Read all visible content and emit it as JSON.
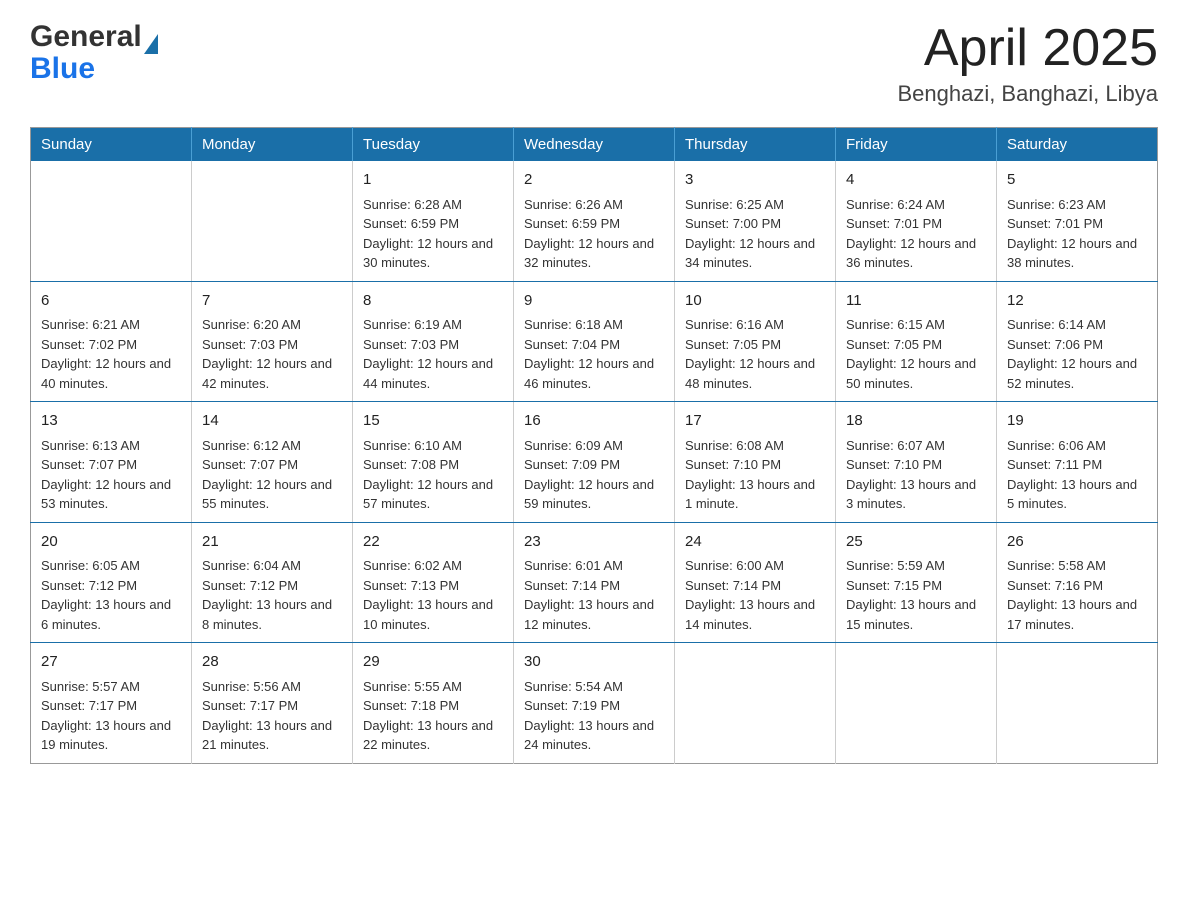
{
  "header": {
    "logo_general": "General",
    "logo_blue": "Blue",
    "month_title": "April 2025",
    "location": "Benghazi, Banghazi, Libya"
  },
  "days_of_week": [
    "Sunday",
    "Monday",
    "Tuesday",
    "Wednesday",
    "Thursday",
    "Friday",
    "Saturday"
  ],
  "weeks": [
    [
      {
        "day": "",
        "sunrise": "",
        "sunset": "",
        "daylight": ""
      },
      {
        "day": "",
        "sunrise": "",
        "sunset": "",
        "daylight": ""
      },
      {
        "day": "1",
        "sunrise": "Sunrise: 6:28 AM",
        "sunset": "Sunset: 6:59 PM",
        "daylight": "Daylight: 12 hours and 30 minutes."
      },
      {
        "day": "2",
        "sunrise": "Sunrise: 6:26 AM",
        "sunset": "Sunset: 6:59 PM",
        "daylight": "Daylight: 12 hours and 32 minutes."
      },
      {
        "day": "3",
        "sunrise": "Sunrise: 6:25 AM",
        "sunset": "Sunset: 7:00 PM",
        "daylight": "Daylight: 12 hours and 34 minutes."
      },
      {
        "day": "4",
        "sunrise": "Sunrise: 6:24 AM",
        "sunset": "Sunset: 7:01 PM",
        "daylight": "Daylight: 12 hours and 36 minutes."
      },
      {
        "day": "5",
        "sunrise": "Sunrise: 6:23 AM",
        "sunset": "Sunset: 7:01 PM",
        "daylight": "Daylight: 12 hours and 38 minutes."
      }
    ],
    [
      {
        "day": "6",
        "sunrise": "Sunrise: 6:21 AM",
        "sunset": "Sunset: 7:02 PM",
        "daylight": "Daylight: 12 hours and 40 minutes."
      },
      {
        "day": "7",
        "sunrise": "Sunrise: 6:20 AM",
        "sunset": "Sunset: 7:03 PM",
        "daylight": "Daylight: 12 hours and 42 minutes."
      },
      {
        "day": "8",
        "sunrise": "Sunrise: 6:19 AM",
        "sunset": "Sunset: 7:03 PM",
        "daylight": "Daylight: 12 hours and 44 minutes."
      },
      {
        "day": "9",
        "sunrise": "Sunrise: 6:18 AM",
        "sunset": "Sunset: 7:04 PM",
        "daylight": "Daylight: 12 hours and 46 minutes."
      },
      {
        "day": "10",
        "sunrise": "Sunrise: 6:16 AM",
        "sunset": "Sunset: 7:05 PM",
        "daylight": "Daylight: 12 hours and 48 minutes."
      },
      {
        "day": "11",
        "sunrise": "Sunrise: 6:15 AM",
        "sunset": "Sunset: 7:05 PM",
        "daylight": "Daylight: 12 hours and 50 minutes."
      },
      {
        "day": "12",
        "sunrise": "Sunrise: 6:14 AM",
        "sunset": "Sunset: 7:06 PM",
        "daylight": "Daylight: 12 hours and 52 minutes."
      }
    ],
    [
      {
        "day": "13",
        "sunrise": "Sunrise: 6:13 AM",
        "sunset": "Sunset: 7:07 PM",
        "daylight": "Daylight: 12 hours and 53 minutes."
      },
      {
        "day": "14",
        "sunrise": "Sunrise: 6:12 AM",
        "sunset": "Sunset: 7:07 PM",
        "daylight": "Daylight: 12 hours and 55 minutes."
      },
      {
        "day": "15",
        "sunrise": "Sunrise: 6:10 AM",
        "sunset": "Sunset: 7:08 PM",
        "daylight": "Daylight: 12 hours and 57 minutes."
      },
      {
        "day": "16",
        "sunrise": "Sunrise: 6:09 AM",
        "sunset": "Sunset: 7:09 PM",
        "daylight": "Daylight: 12 hours and 59 minutes."
      },
      {
        "day": "17",
        "sunrise": "Sunrise: 6:08 AM",
        "sunset": "Sunset: 7:10 PM",
        "daylight": "Daylight: 13 hours and 1 minute."
      },
      {
        "day": "18",
        "sunrise": "Sunrise: 6:07 AM",
        "sunset": "Sunset: 7:10 PM",
        "daylight": "Daylight: 13 hours and 3 minutes."
      },
      {
        "day": "19",
        "sunrise": "Sunrise: 6:06 AM",
        "sunset": "Sunset: 7:11 PM",
        "daylight": "Daylight: 13 hours and 5 minutes."
      }
    ],
    [
      {
        "day": "20",
        "sunrise": "Sunrise: 6:05 AM",
        "sunset": "Sunset: 7:12 PM",
        "daylight": "Daylight: 13 hours and 6 minutes."
      },
      {
        "day": "21",
        "sunrise": "Sunrise: 6:04 AM",
        "sunset": "Sunset: 7:12 PM",
        "daylight": "Daylight: 13 hours and 8 minutes."
      },
      {
        "day": "22",
        "sunrise": "Sunrise: 6:02 AM",
        "sunset": "Sunset: 7:13 PM",
        "daylight": "Daylight: 13 hours and 10 minutes."
      },
      {
        "day": "23",
        "sunrise": "Sunrise: 6:01 AM",
        "sunset": "Sunset: 7:14 PM",
        "daylight": "Daylight: 13 hours and 12 minutes."
      },
      {
        "day": "24",
        "sunrise": "Sunrise: 6:00 AM",
        "sunset": "Sunset: 7:14 PM",
        "daylight": "Daylight: 13 hours and 14 minutes."
      },
      {
        "day": "25",
        "sunrise": "Sunrise: 5:59 AM",
        "sunset": "Sunset: 7:15 PM",
        "daylight": "Daylight: 13 hours and 15 minutes."
      },
      {
        "day": "26",
        "sunrise": "Sunrise: 5:58 AM",
        "sunset": "Sunset: 7:16 PM",
        "daylight": "Daylight: 13 hours and 17 minutes."
      }
    ],
    [
      {
        "day": "27",
        "sunrise": "Sunrise: 5:57 AM",
        "sunset": "Sunset: 7:17 PM",
        "daylight": "Daylight: 13 hours and 19 minutes."
      },
      {
        "day": "28",
        "sunrise": "Sunrise: 5:56 AM",
        "sunset": "Sunset: 7:17 PM",
        "daylight": "Daylight: 13 hours and 21 minutes."
      },
      {
        "day": "29",
        "sunrise": "Sunrise: 5:55 AM",
        "sunset": "Sunset: 7:18 PM",
        "daylight": "Daylight: 13 hours and 22 minutes."
      },
      {
        "day": "30",
        "sunrise": "Sunrise: 5:54 AM",
        "sunset": "Sunset: 7:19 PM",
        "daylight": "Daylight: 13 hours and 24 minutes."
      },
      {
        "day": "",
        "sunrise": "",
        "sunset": "",
        "daylight": ""
      },
      {
        "day": "",
        "sunrise": "",
        "sunset": "",
        "daylight": ""
      },
      {
        "day": "",
        "sunrise": "",
        "sunset": "",
        "daylight": ""
      }
    ]
  ]
}
